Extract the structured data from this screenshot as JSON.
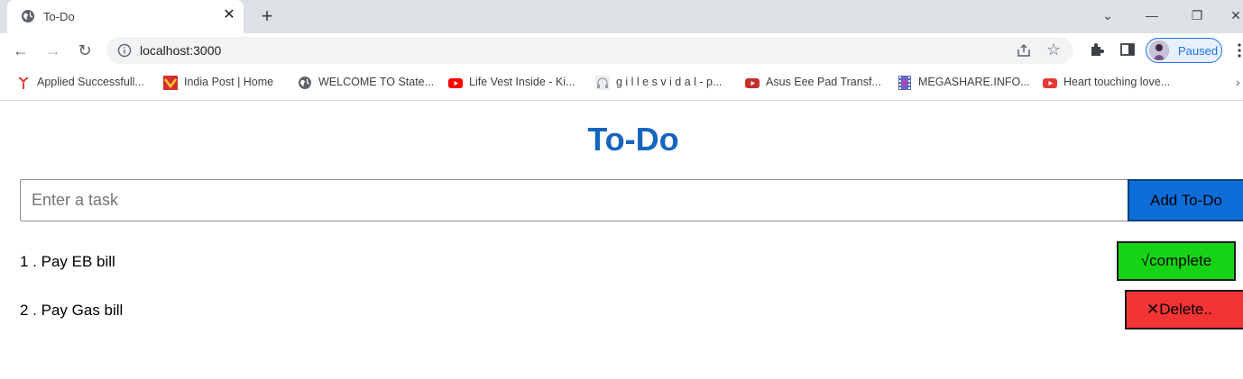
{
  "browser": {
    "tab_title": "To-Do",
    "url": "localhost:3000",
    "profile_label": "Paused",
    "bookmarks": [
      {
        "label": "Applied Successfull...",
        "icon": "red-y-icon"
      },
      {
        "label": "India Post | Home",
        "icon": "india-post-icon"
      },
      {
        "label": "WELCOME TO State...",
        "icon": "globe-icon"
      },
      {
        "label": "Life Vest Inside - Ki...",
        "icon": "youtube-icon"
      },
      {
        "label": "g i l l e s v i d a l - p...",
        "icon": "headphones-icon"
      },
      {
        "label": "Asus Eee Pad Transf...",
        "icon": "youtube-icon"
      },
      {
        "label": "MEGASHARE.INFO...",
        "icon": "film-icon"
      },
      {
        "label": "Heart touching love...",
        "icon": "youtube-icon"
      }
    ]
  },
  "app": {
    "title": "To-Do",
    "input_placeholder": "Enter a task",
    "input_value": "",
    "add_button_label": "Add To-Do",
    "todos": [
      {
        "text": "1 . Pay EB bill",
        "action_label": "√complete"
      },
      {
        "text": "2 . Pay Gas bill",
        "action_label": "✕Delete.."
      }
    ]
  },
  "colors": {
    "title": "#1565c0",
    "add_button": "#0d6ed9",
    "complete_button": "#17d316",
    "delete_button": "#f43335"
  }
}
